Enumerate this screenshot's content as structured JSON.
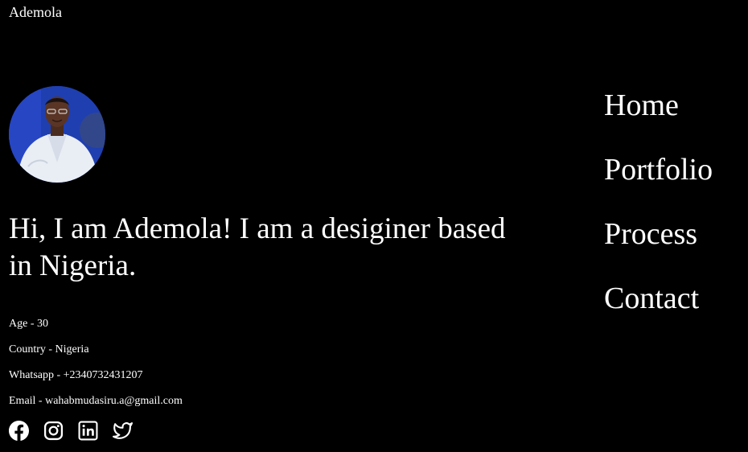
{
  "brand": {
    "name": "Ademola"
  },
  "profile": {
    "avatar_icon": "profile-photo",
    "headline": "Hi, I am Ademola! I am a desiginer based in Nigeria."
  },
  "details": [
    {
      "text": "Age - 30"
    },
    {
      "text": "Country - Nigeria"
    },
    {
      "text": "Whatsapp - +2340732431207"
    },
    {
      "text": "Email - wahabmudasiru.a@gmail.com"
    }
  ],
  "socials": [
    {
      "icon": "facebook-icon"
    },
    {
      "icon": "instagram-icon"
    },
    {
      "icon": "linkedin-icon"
    },
    {
      "icon": "twitter-icon"
    }
  ],
  "nav": {
    "items": [
      {
        "label": "Home"
      },
      {
        "label": "Portfolio"
      },
      {
        "label": "Process"
      },
      {
        "label": "Contact"
      }
    ]
  },
  "colors": {
    "background": "#000000",
    "text": "#ffffff"
  }
}
